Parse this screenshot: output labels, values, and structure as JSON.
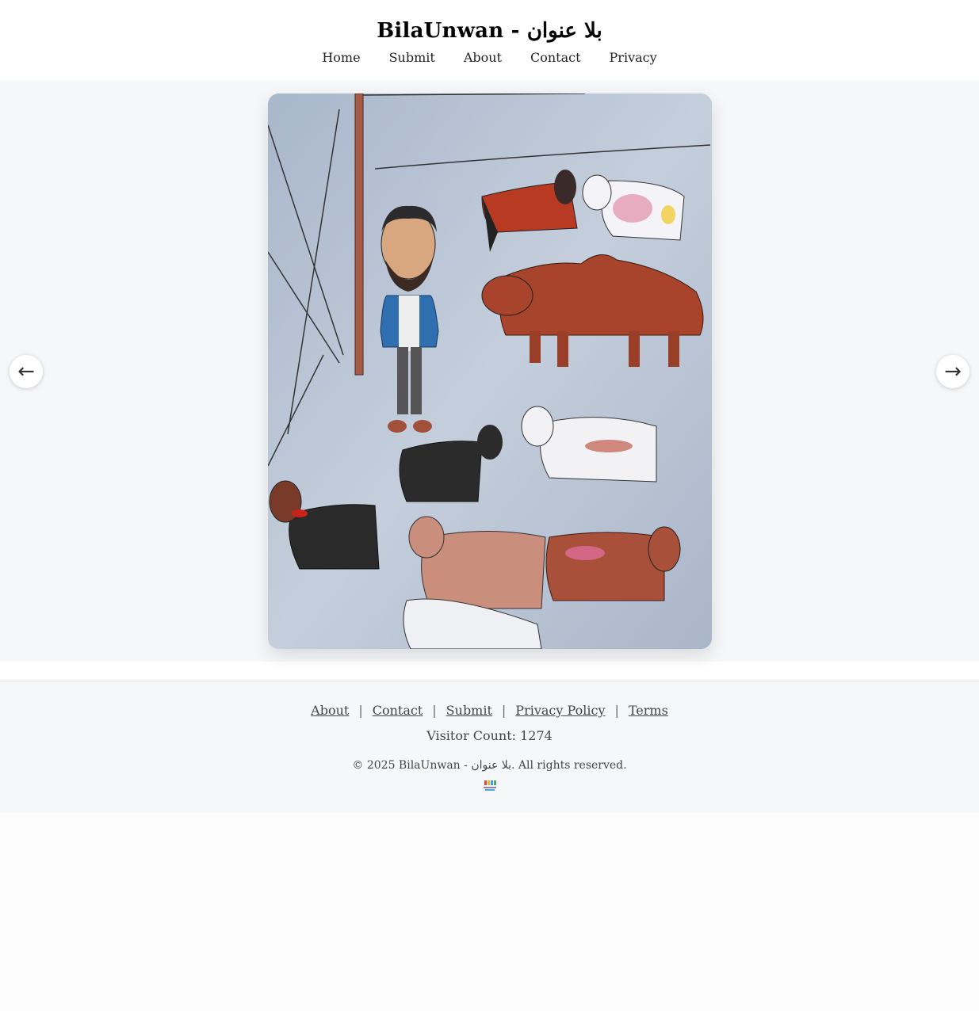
{
  "header": {
    "site_title": "BilaUnwan - بلا عنوان",
    "nav": [
      "Home",
      "Submit",
      "About",
      "Contact",
      "Privacy"
    ]
  },
  "gallery": {
    "prev_icon": "←",
    "next_icon": "→",
    "image_description_icon": "drawing-artwork"
  },
  "footer": {
    "links": [
      "About",
      "Contact",
      "Submit",
      "Privacy Policy",
      "Terms"
    ],
    "separator": "|",
    "visitor_count": "Visitor Count: 1274",
    "copyright": "© 2025 BilaUnwan - بلا عنوان. All rights reserved."
  },
  "colors": {
    "header_bg": "#ffffff",
    "gallery_bg": "#f6f7f9",
    "footer_bg": "#f6f7f9"
  }
}
